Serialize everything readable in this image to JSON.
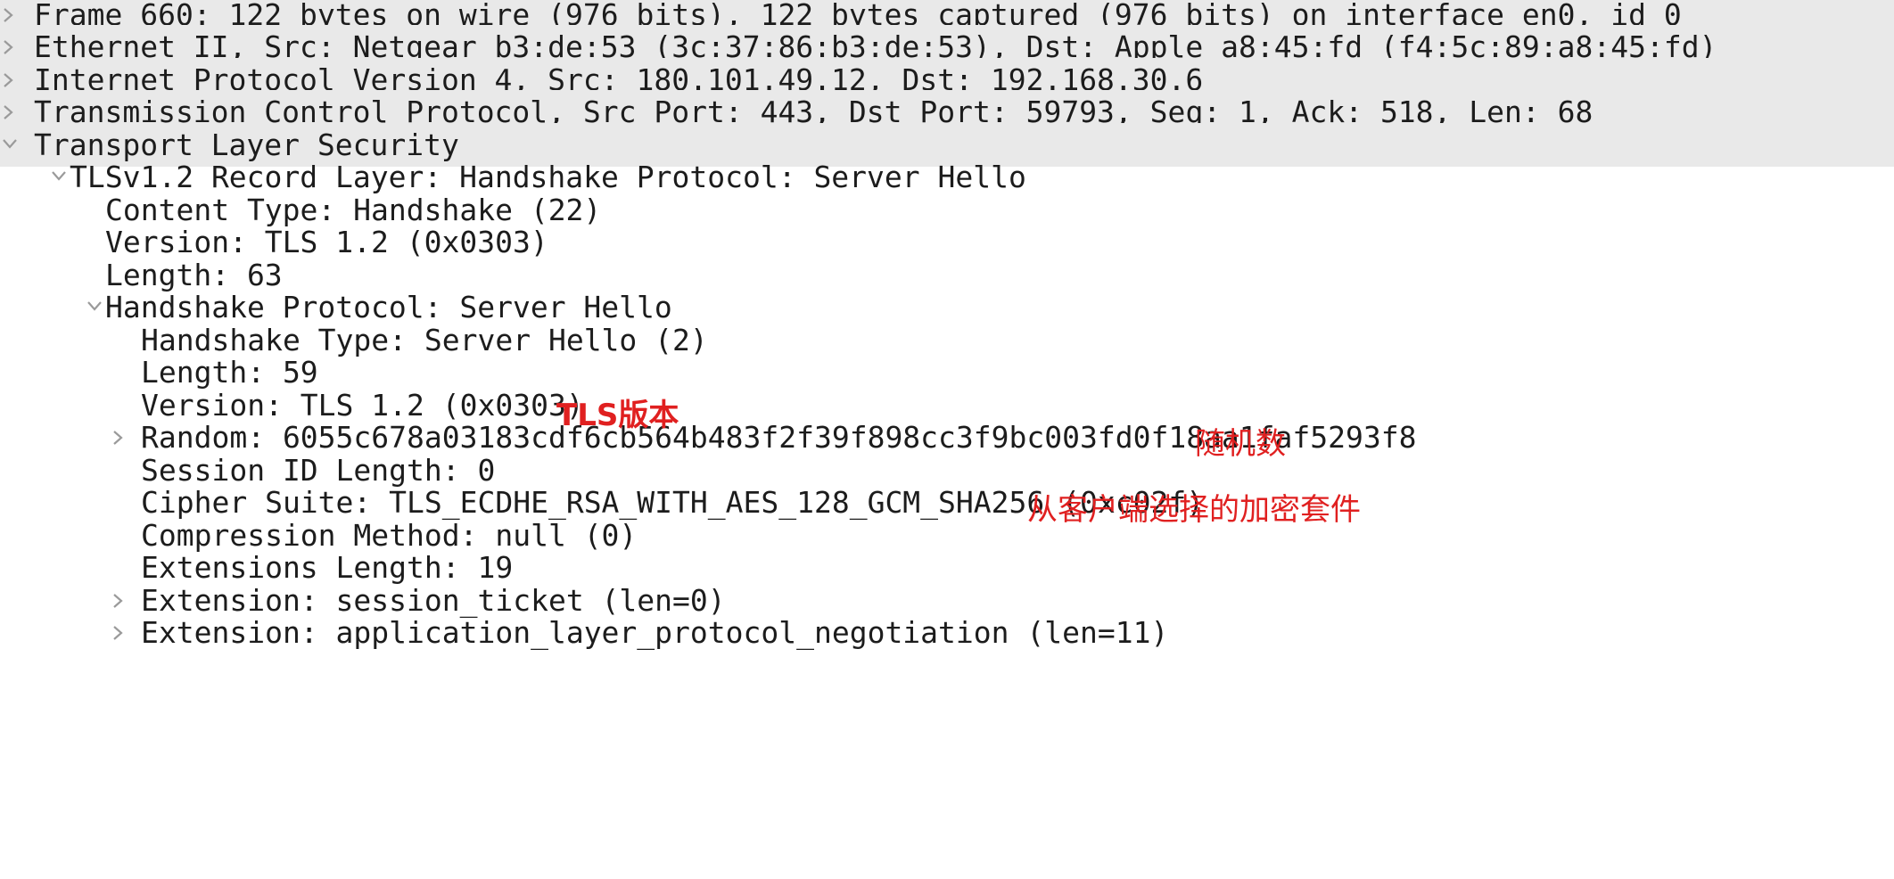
{
  "tree": {
    "frame": "Frame 660: 122 bytes on wire (976 bits), 122 bytes captured (976 bits) on interface en0, id 0",
    "ethernet": "Ethernet II, Src: Netgear_b3:de:53 (3c:37:86:b3:de:53), Dst: Apple_a8:45:fd (f4:5c:89:a8:45:fd)",
    "ip": "Internet Protocol Version 4, Src: 180.101.49.12, Dst: 192.168.30.6",
    "tcp": "Transmission Control Protocol, Src Port: 443, Dst Port: 59793, Seq: 1, Ack: 518, Len: 68",
    "tls": "Transport Layer Security",
    "record_layer": "TLSv1.2 Record Layer: Handshake Protocol: Server Hello",
    "content_type": "Content Type: Handshake (22)",
    "record_version": "Version: TLS 1.2 (0x0303)",
    "record_length": "Length: 63",
    "handshake_protocol": "Handshake Protocol: Server Hello",
    "handshake_type": "Handshake Type: Server Hello (2)",
    "handshake_length": "Length: 59",
    "handshake_version": "Version: TLS 1.2 (0x0303)",
    "random": "Random: 6055c678a03183cdf6cb564b483f2f39f898cc3f9bc003fd0f18aa1faf5293f8",
    "session_id_length": "Session ID Length: 0",
    "cipher_suite": "Cipher Suite: TLS_ECDHE_RSA_WITH_AES_128_GCM_SHA256 (0xc02f)",
    "compression": "Compression Method: null (0)",
    "extensions_length": "Extensions Length: 19",
    "ext_session_ticket": "Extension: session_ticket (len=0)",
    "ext_alpn": "Extension: application_layer_protocol_negotiation (len=11)"
  },
  "annotations": {
    "tls_version": "TLS版本",
    "random_number": "随机数",
    "cipher_suite": "从客户端选择的加密套件"
  },
  "colors": {
    "annotation": "#e02020",
    "row_highlight": "#e9e9e9",
    "toggle": "#9a9a9a",
    "text": "#1c1c1c"
  }
}
